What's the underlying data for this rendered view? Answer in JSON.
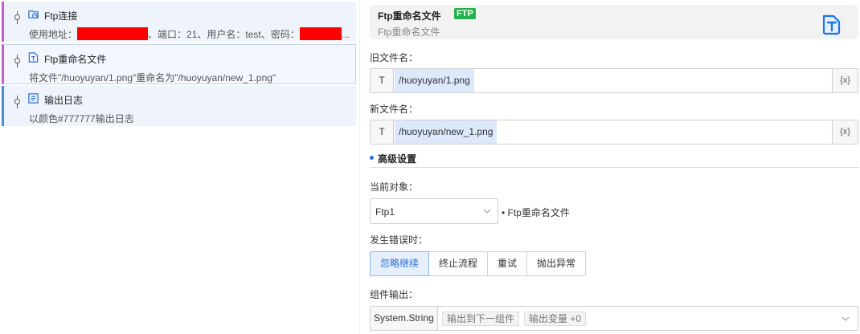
{
  "flow": {
    "items": [
      {
        "title": "Ftp连接",
        "desc_prefix": "使用地址：",
        "desc_mid": "、端口：21、用户名：test、密码：",
        "desc_suffix": "..."
      },
      {
        "title": "Ftp重命名文件",
        "desc": "将文件\"/huoyuyan/1.png\"重命名为\"/huoyuyan/new_1.png\""
      },
      {
        "title": "输出日志",
        "desc": "以颜色#777777输出日志"
      }
    ]
  },
  "header": {
    "title": "Ftp重命名文件",
    "badge": "FTP",
    "subtitle": "Ftp重命名文件",
    "icon": "ftp-file-icon"
  },
  "fields": {
    "old_name": {
      "label": "旧文件名：",
      "prefix": "T",
      "value": "/huoyuyan/1.png",
      "var_button": "{x}"
    },
    "new_name": {
      "label": "新文件名：",
      "prefix": "T",
      "value": "/huoyuyan/new_1.png",
      "var_button": "{x}"
    }
  },
  "advanced": {
    "title": "高级设置",
    "current_object_label": "当前对象：",
    "current_object_value": "Ftp1",
    "current_object_note": "• Ftp重命名文件",
    "on_error_label": "发生错误时：",
    "on_error_options": [
      "忽略继续",
      "终止流程",
      "重试",
      "抛出异常"
    ],
    "on_error_selected": 0,
    "output_label": "组件输出：",
    "output_type": "System.String",
    "output_tags": [
      "输出到下一组件",
      "输出变量 +0"
    ]
  },
  "colors": {
    "accent": "#2a6fd6",
    "badge_green": "#22b14c",
    "flow_purple": "#c060d0",
    "flow_blue": "#4a90d6",
    "redacted": "#ff0000"
  }
}
